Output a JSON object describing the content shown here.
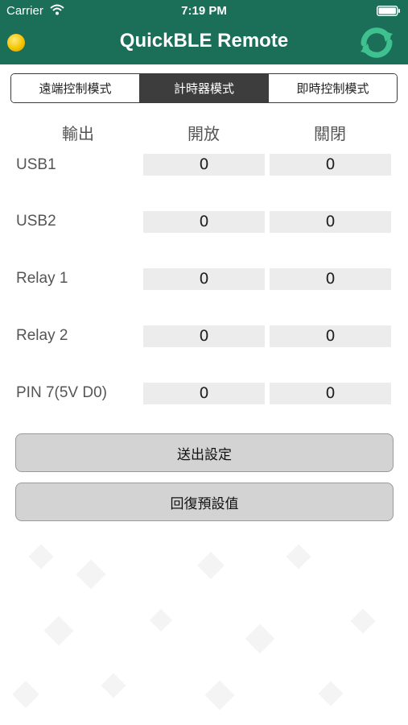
{
  "status_bar": {
    "carrier": "Carrier",
    "time": "7:19 PM"
  },
  "header": {
    "title": "QuickBLE Remote",
    "accent_color": "#1b6e58",
    "status_dot_color": "#f5c400"
  },
  "tabs": [
    {
      "label": "遠端控制模式",
      "active": false
    },
    {
      "label": "計時器模式",
      "active": true
    },
    {
      "label": "即時控制模式",
      "active": false
    }
  ],
  "table": {
    "columns": [
      "輸出",
      "開放",
      "關閉"
    ],
    "rows": [
      {
        "label": "USB1",
        "open": "0",
        "close": "0"
      },
      {
        "label": "USB2",
        "open": "0",
        "close": "0"
      },
      {
        "label": "Relay 1",
        "open": "0",
        "close": "0"
      },
      {
        "label": "Relay 2",
        "open": "0",
        "close": "0"
      },
      {
        "label": "PIN 7(5V D0)",
        "open": "0",
        "close": "0"
      }
    ]
  },
  "actions": {
    "send_label": "送出設定",
    "reset_label": "回復預設值"
  }
}
